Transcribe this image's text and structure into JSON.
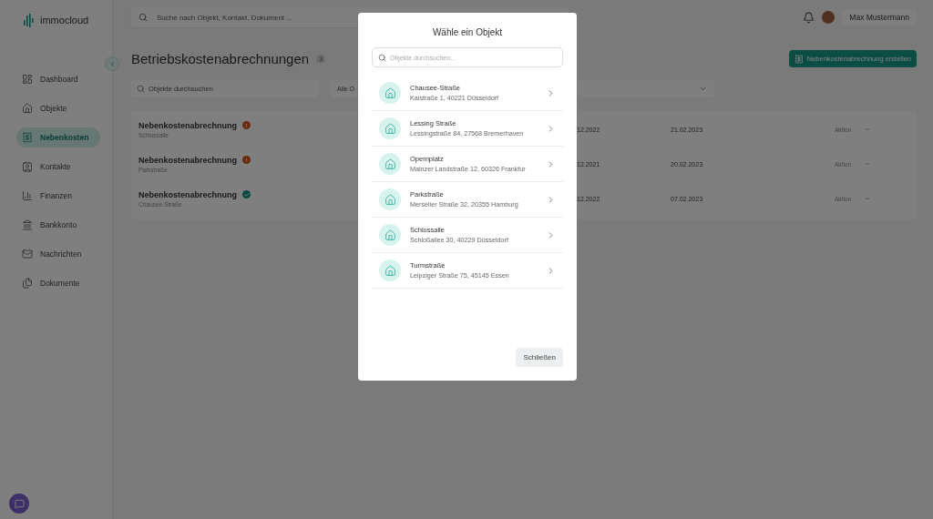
{
  "brand": {
    "name": "immocloud"
  },
  "sidebar": {
    "items": [
      {
        "label": "Dashboard",
        "kind": "dashboard",
        "selected": false
      },
      {
        "label": "Objekte",
        "kind": "house",
        "selected": false
      },
      {
        "label": "Nebenkosten",
        "kind": "bills",
        "selected": true
      },
      {
        "label": "Kontakte",
        "kind": "contact",
        "selected": false
      },
      {
        "label": "Finanzen",
        "kind": "chart",
        "selected": false
      },
      {
        "label": "Bankkonto",
        "kind": "bank",
        "selected": false
      },
      {
        "label": "Nachrichten",
        "kind": "mail",
        "selected": false
      },
      {
        "label": "Dokumente",
        "kind": "docs",
        "selected": false
      }
    ]
  },
  "topbar": {
    "search": {
      "placeholder": "Suche nach Objekt, Kontakt, Dokument ..."
    },
    "user": {
      "name": "Max Mustermann"
    }
  },
  "page": {
    "title": "Betriebskostenabrechnungen",
    "count": "3",
    "create_button": "Nebenkostenabrechnung erstellen",
    "filter_search": {
      "placeholder": "Objekte durchsuchen"
    },
    "filter_select": {
      "value": "Alle O"
    }
  },
  "table": {
    "rows": [
      {
        "title": "Nebenkostenabrechnung",
        "object": "Schlossalle",
        "kind": "open",
        "status_mark": "!",
        "period_end": "12.2022",
        "date": "21.02.2023",
        "action": "Aktion"
      },
      {
        "title": "Nebenkostenabrechnung",
        "object": "Parkstraße",
        "kind": "open",
        "status_mark": "!",
        "period_end": "12.2021",
        "date": "20.02.2023",
        "action": "Aktion"
      },
      {
        "title": "Nebenkostenabrechnung",
        "object": "Chausee-Straße",
        "kind": "done",
        "period_end": "12.2022",
        "date": "07.02.2023",
        "action": "Aktion"
      }
    ]
  },
  "modal": {
    "title": "Wähle ein Objekt",
    "search": {
      "placeholder": "Objekte durchsuchen..."
    },
    "objects": [
      {
        "name": "Chausee-Straße",
        "address": "Kaistraße 1, 40221 Düsseldorf"
      },
      {
        "name": "Lessing Straße",
        "address": "Lessingstraße 84, 27568 Bremerhaven"
      },
      {
        "name": "Opernplatz",
        "address": "Mainzer Landstraße 12, 60326 Frankfur"
      },
      {
        "name": "Parkstraße",
        "address": "Merseller Straße 32, 20355 Hamburg"
      },
      {
        "name": "Schlossalle",
        "address": "Schloßallee 30, 40229 Düsseldorf"
      },
      {
        "name": "Turmstraße",
        "address": "Leipziger Straße 75, 45145 Essen"
      }
    ],
    "close_button": "Schließen"
  }
}
